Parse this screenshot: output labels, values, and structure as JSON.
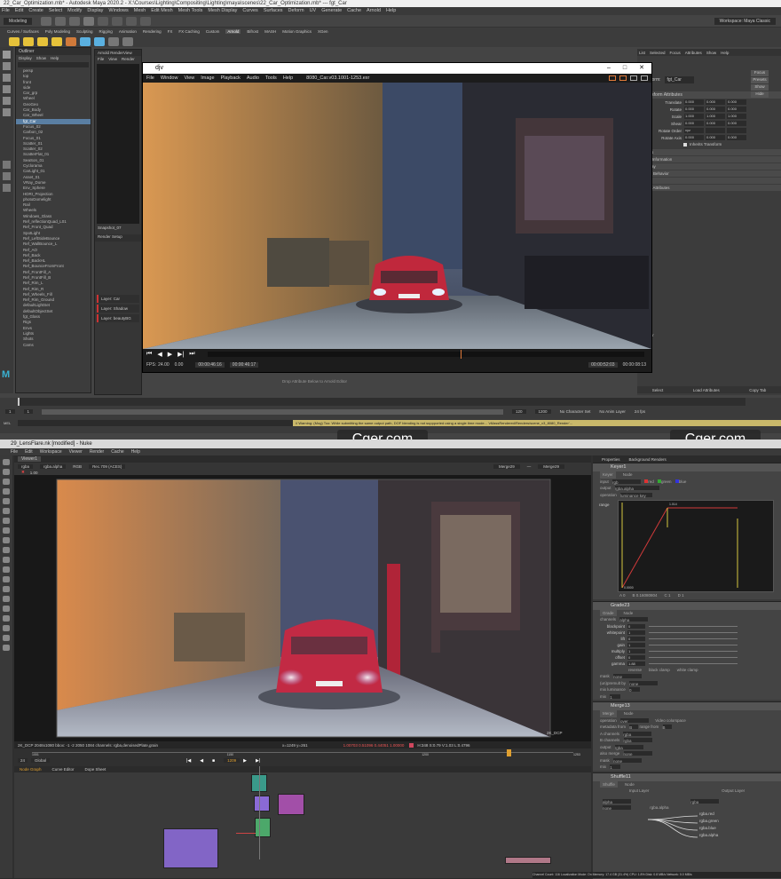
{
  "maya": {
    "title": "22_Car_Optimization.mb* - Autodesk Maya 2020.2 - X:\\Courses\\Lighting\\Compositing\\Lighting\\maya\\scenes\\22_Car_Optimization.mb* --- fgt_Car",
    "menus": [
      "File",
      "Edit",
      "Create",
      "Select",
      "Modify",
      "Display",
      "Windows",
      "Mesh",
      "Edit Mesh",
      "Mesh Tools",
      "Mesh Display",
      "Curves",
      "Surfaces",
      "Deform",
      "UV",
      "Generate",
      "Cache",
      "Arnold",
      "Help"
    ],
    "workspace": "Workspace: Maya Classic",
    "mode": "Modeling",
    "shelf_tabs": [
      "Curves / Surfaces",
      "Poly Modeling",
      "Sculpting",
      "Rigging",
      "Animation",
      "Rendering",
      "FX",
      "FX Caching",
      "Custom",
      "Arnold",
      "Bifrost",
      "MASH",
      "Motion Graphics",
      "XGen"
    ],
    "outliner": {
      "title": "Outliner",
      "menu": [
        "Display",
        "Show",
        "Help"
      ],
      "items": [
        "persp",
        "top",
        "front",
        "side",
        "Car_grp",
        "Wheel",
        "GeoGeo",
        "Car_Body",
        "Car_Wheel",
        "fgt_Car",
        "Focus_02",
        "Carbon_02",
        "Focus_01",
        "Scatter_01",
        "Scatter_02",
        "ScatterFlat_01",
        "SeaSon_01",
        "Cyclorama",
        "CarLight_01",
        "Asset_01",
        "VRay_Dome",
        "Env_Sphere",
        "HDRI_Projection",
        "photoDomelight",
        "Rail",
        "Wheels",
        "Windows_Glass",
        "Ref_reflectionQuad_L01",
        "Ref_Front_Quad",
        "SpotLight",
        "Ref_LeftSideBounce",
        "Ref_WallBounce_L",
        "Ref_AO",
        "Ref_Back",
        "Ref_BackHL",
        "Ref_BounceFromFront",
        "Ref_FrontFill_A",
        "Ref_FrontFill_B",
        "Ref_Rim_L",
        "Ref_Rim_R",
        "Ref_Wheels_Fill",
        "Ref_Rim_Ground",
        "defaultLightSet",
        "defaultObjectSet",
        "fgt_Glass",
        "Rigs",
        "Envs",
        "Lights",
        "Shots",
        "Cams"
      ],
      "selected": "fgt_Car"
    },
    "arnold_rv": {
      "title": "Arnold RenderView",
      "menu": [
        "File",
        "View",
        "Render"
      ],
      "snapshot": "Snapshot_07",
      "render_setup": "Render Setup",
      "layers": [
        "Layer: Car",
        "Layer: Shadow",
        "Layer: beautyBG"
      ]
    },
    "flix": {
      "title": "djv",
      "menus": [
        "File",
        "Window",
        "View",
        "Image",
        "Playback",
        "Audio",
        "Tools",
        "Help"
      ],
      "file": "8080_Car.v03.1001-1253.exr",
      "fps": "24.00",
      "speed": "0.00",
      "in_tc": "00:00:46:16",
      "out_tc": "00:00:46:17",
      "current_tc": "00:00:52:03",
      "end_tc": "00:00:08:13",
      "playhead": 0.58
    },
    "attribute_editor": {
      "tabs": [
        "List",
        "Selected",
        "Focus",
        "Attributes",
        "Show",
        "Help"
      ],
      "node": "fgt_Car",
      "buttons": [
        "Focus",
        "Presets",
        "Show",
        "Hide"
      ],
      "section": "Transform Attributes",
      "attrs": [
        {
          "label": "Translate",
          "v": [
            "0.000",
            "0.000",
            "0.000"
          ]
        },
        {
          "label": "Rotate",
          "v": [
            "0.000",
            "0.000",
            "0.000"
          ]
        },
        {
          "label": "Scale",
          "v": [
            "1.000",
            "1.000",
            "1.000"
          ]
        },
        {
          "label": "Shear",
          "v": [
            "0.000",
            "0.000",
            "0.000"
          ]
        },
        {
          "label": "Rotate Order",
          "v": [
            "xyz",
            "",
            ""
          ]
        },
        {
          "label": "Rotate Axis",
          "v": [
            "0.000",
            "0.000",
            "0.000"
          ]
        }
      ],
      "inherits": "Inherits Transform",
      "collapsed": [
        "Pivots",
        "Limit Information",
        "Display",
        "Node Behavior",
        "UUID",
        "Extra Attributes"
      ],
      "footer_buttons": [
        "Select",
        "Load Attributes",
        "Copy Tab"
      ],
      "notes": "fgt_Car"
    },
    "timeline": {
      "start": "1",
      "end": "120",
      "current": "1",
      "range_end": "1200",
      "charset": "No Character Set",
      "anim_layer": "No Anim Layer",
      "fps": "24 fps"
    },
    "warning": "// Warning: (Mog) Too: While submitting the same output path, DOF blending is not suppported using a single time mode... 'vMassRendered/Renders/scene_v3_8080_Render'... ",
    "cmd_label": "MEL",
    "drop_hint": "Drop Attribute Below to Arnold Editor"
  },
  "nuke": {
    "title": "29_LensFlare.nk [modified] - Nuke",
    "menus": [
      "File",
      "Edit",
      "Workspace",
      "Viewer",
      "Render",
      "Cache",
      "Help"
    ],
    "viewer_tab": "Viewer1",
    "channels": "rgba",
    "layer": "rgba.alpha",
    "colorspace": "RGB",
    "lut": "Rec.709 (ACES)",
    "input_a": "Merge29",
    "input_b": "Merge29",
    "zoom": "1.00",
    "frame_info": "2K_DCP 2048x1080  bbox: -1 -2 2050 1084 channels: rgba,denoisedPlate,grain",
    "pixel_info": "x=1249 y=261",
    "rgba_vals": "1.00703  0.51096  0.44051  1.00000",
    "hsvl": "H:348 S:0.79 V:1.03  L:0.4796",
    "format_label": "2K_DCP",
    "frames": {
      "first": "1001",
      "current": "1209",
      "last": "1253",
      "ticks": [
        "1001",
        "1150",
        "1200",
        "1253"
      ],
      "playhead": 0.88
    },
    "fps": "24",
    "playback_mode": "Global",
    "node_tabs": [
      "Node Graph",
      "Curve Editor",
      "Dope Sheet"
    ],
    "props_tabs": [
      "Properties",
      "Background Renders"
    ],
    "keyer": {
      "name": "Keyer1",
      "tabs": [
        "Keyer",
        "Node"
      ],
      "input": "rgb",
      "output": "rgba.alpha",
      "operation": "luminance key",
      "range_label": "range",
      "range_values": [
        "A  0",
        "B  0.16080804",
        "C  1",
        "D  1"
      ],
      "graph_labels": [
        "1.014",
        "0.0000",
        "1.000",
        "0.0000"
      ]
    },
    "grade": {
      "name": "Grade23",
      "tabs": [
        "Grade",
        "Node"
      ],
      "channels": "alpha",
      "rows": [
        {
          "label": "blackpoint",
          "val": "0"
        },
        {
          "label": "whitepoint",
          "val": "1"
        },
        {
          "label": "lift",
          "val": "0"
        },
        {
          "label": "gain",
          "val": "1"
        },
        {
          "label": "multiply",
          "val": "1"
        },
        {
          "label": "offset",
          "val": "0"
        },
        {
          "label": "gamma",
          "val": "1.88"
        }
      ],
      "checks": [
        "reverse",
        "black clamp",
        "white clamp"
      ],
      "mask": "none",
      "unpremult": "none",
      "mix_luminance": "0",
      "mix": "1"
    },
    "merge": {
      "name": "Merge13",
      "tabs": [
        "Merge",
        "Node"
      ],
      "operation": "over",
      "video_colorspace": "Video colorspace",
      "metadata_from": "B",
      "range_from": "B",
      "a_channels": "rgba",
      "b_channels": "rgba",
      "output": "rgba",
      "also_merge": "none",
      "mask": "none",
      "mix": "1"
    },
    "shuffle": {
      "name": "Shuffle11",
      "tabs": [
        "Shuffle",
        "Node"
      ],
      "input_layer": "Input Layer",
      "output_layer": "Output Layer",
      "in1": "alpha",
      "in2": "none",
      "out1": "rgba",
      "out_channels": [
        "rgba.red",
        "rgba.green",
        "rgba.blue",
        "rgba.alpha"
      ],
      "in_channel": "rgba.alpha"
    },
    "status": "Channel Count: 116  Localization Mode: On  Memory: 17.4 GB (31.4%)  CPU: 1.8%  Disk: 0.8 MB/s  Network: 0.0 MB/s"
  },
  "watermark": "Cger.com",
  "colors": {
    "maya_bg": "#444444",
    "nuke_bg": "#2f2f2f",
    "node_teal": "#3a9a8a",
    "node_purple": "#8a6ad6",
    "node_magenta": "#a24fa8",
    "node_green": "#4ca86a",
    "accent_yellow": "#d4c640",
    "accent_red": "#c93a3a"
  }
}
